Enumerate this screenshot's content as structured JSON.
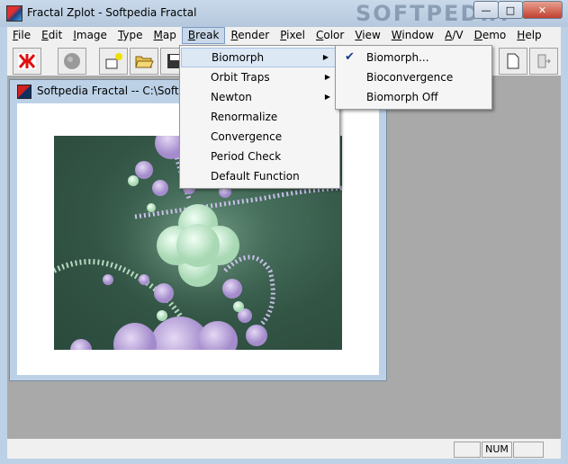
{
  "window": {
    "title": "Fractal Zplot - Softpedia Fractal",
    "watermark": "SOFTPEDIA"
  },
  "menubar": [
    {
      "pre": "",
      "u": "F",
      "post": "ile"
    },
    {
      "pre": "",
      "u": "E",
      "post": "dit"
    },
    {
      "pre": "",
      "u": "I",
      "post": "mage"
    },
    {
      "pre": "",
      "u": "T",
      "post": "ype"
    },
    {
      "pre": "",
      "u": "M",
      "post": "ap"
    },
    {
      "pre": "",
      "u": "B",
      "post": "reak"
    },
    {
      "pre": "",
      "u": "R",
      "post": "ender"
    },
    {
      "pre": "",
      "u": "P",
      "post": "ixel"
    },
    {
      "pre": "",
      "u": "C",
      "post": "olor"
    },
    {
      "pre": "",
      "u": "V",
      "post": "iew"
    },
    {
      "pre": "",
      "u": "W",
      "post": "indow"
    },
    {
      "pre": "",
      "u": "A",
      "post": "/V"
    },
    {
      "pre": "",
      "u": "D",
      "post": "emo"
    },
    {
      "pre": "",
      "u": "H",
      "post": "elp"
    }
  ],
  "break_menu": {
    "items": [
      {
        "label": "Biomorph",
        "submenu": true
      },
      {
        "label": "Orbit Traps",
        "submenu": true
      },
      {
        "label": "Newton",
        "submenu": true
      },
      {
        "label": "Renormalize",
        "submenu": false
      },
      {
        "label": "Convergence",
        "submenu": false
      },
      {
        "label": "Period Check",
        "submenu": false
      },
      {
        "label": "Default Function",
        "submenu": false
      }
    ]
  },
  "biomorph_submenu": {
    "items": [
      {
        "label": "Biomorph...",
        "checked": true
      },
      {
        "label": "Bioconvergence",
        "checked": false
      },
      {
        "label": "Biomorph Off",
        "checked": false
      }
    ]
  },
  "child_window": {
    "title": "Softpedia Fractal -- C:\\Softped"
  },
  "statusbar": {
    "num": "NUM"
  },
  "colors": {
    "fractal_bg": "#335545",
    "menu_highlight": "#dde8f5"
  }
}
